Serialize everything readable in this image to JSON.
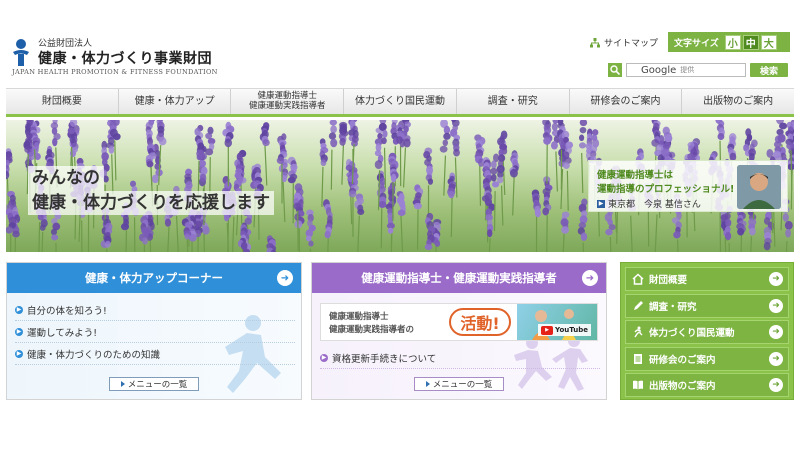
{
  "header": {
    "org_type": "公益財団法人",
    "org_name": "健康・体力づくり事業財団",
    "org_name_en": "JAPAN HEALTH PROMOTION & FITNESS FOUNDATION",
    "sitemap_label": "サイトマップ",
    "font_size_label": "文字サイズ",
    "font_sizes": [
      "小",
      "中",
      "大"
    ],
    "search_provider": "Google",
    "search_provider_suffix": "提供",
    "search_button": "検索"
  },
  "nav": {
    "items": [
      {
        "label": "財団概要"
      },
      {
        "label": "健康・体力アップ"
      },
      {
        "label_line1": "健康運動指導士",
        "label_line2": "健康運動実践指導者"
      },
      {
        "label": "体力づくり国民運動"
      },
      {
        "label": "調査・研究"
      },
      {
        "label": "研修会のご案内"
      },
      {
        "label": "出版物のご案内"
      }
    ]
  },
  "hero": {
    "line1": "みんなの",
    "line2": "健康・体力づくりを応援します",
    "promo_line1": "健康運動指導士は",
    "promo_line2": "運動指導のプロフェッショナル!",
    "promo_line3": "東京都　今泉 基信さん"
  },
  "panel_fitness": {
    "title": "健康・体力アップコーナー",
    "items": [
      "自分の体を知ろう!",
      "運動してみよう!",
      "健康・体力づくりのための知識"
    ],
    "menu_label": "メニューの一覧"
  },
  "panel_instructor": {
    "title": "健康運動指導士・健康運動実践指導者",
    "banner_line1": "健康運動指導士",
    "banner_line2": "健康運動実践指導者の",
    "banner_highlight": "活動!",
    "banner_badge": "YouTube",
    "items": [
      "資格更新手続きについて"
    ],
    "menu_label": "メニューの一覧"
  },
  "side_nav": {
    "items": [
      {
        "label": "財団概要",
        "icon": "home-icon"
      },
      {
        "label": "調査・研究",
        "icon": "pencil-icon"
      },
      {
        "label": "体力づくり国民運動",
        "icon": "runner-icon"
      },
      {
        "label": "研修会のご案内",
        "icon": "document-icon"
      },
      {
        "label": "出版物のご案内",
        "icon": "book-icon"
      }
    ]
  },
  "colors": {
    "accent_green": "#7cb342",
    "fitness_blue": "#2f8fd8",
    "instructor_purple": "#9a6bc8"
  }
}
